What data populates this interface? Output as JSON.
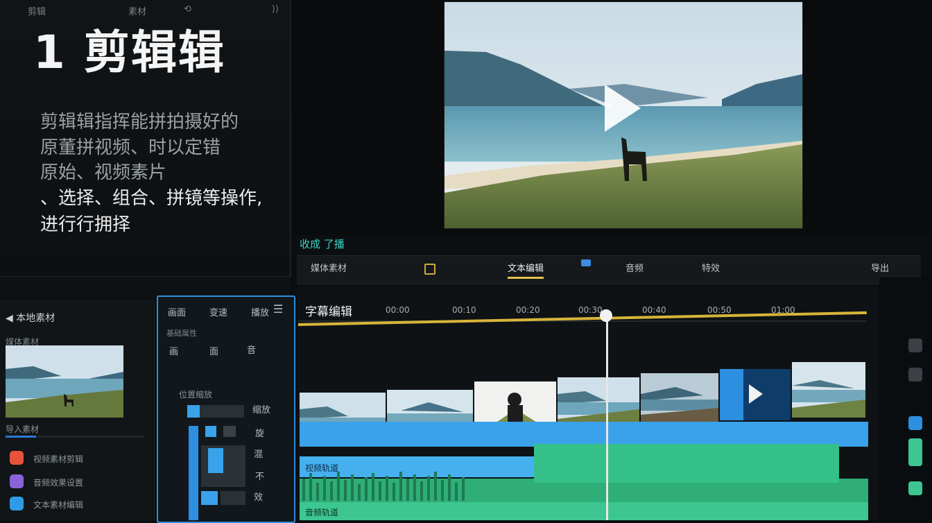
{
  "intro": {
    "title": "1 剪辑辑",
    "lines": [
      "剪辑辑指挥能拼拍摄好的",
      "原董拼视频、时以定错",
      "原始、视频素片",
      "、选择、组合、拼镜等操作,",
      "进行行拥择"
    ],
    "footer": [
      "剪辑",
      "素材",
      "⟲",
      "⟩⟩"
    ]
  },
  "preview": {
    "play_icon": "play-triangle"
  },
  "toolbar": {
    "status_label": "收成 了播"
  },
  "tabs": [
    "媒体素材",
    "",
    "文本编辑",
    "音频",
    "特效",
    "导出"
  ],
  "media": {
    "header": "◀ 本地素材",
    "sub": "媒体素材",
    "label": "导入素材",
    "progress": 0.22,
    "apps": [
      {
        "label": "视频素材剪辑",
        "color": "#e8543a"
      },
      {
        "label": "音频效果设置",
        "color": "#8a63d8"
      },
      {
        "label": "文本素材编辑",
        "color": "#2f9be8"
      }
    ]
  },
  "props": {
    "tabs": [
      "画面",
      "变速",
      "播放"
    ],
    "sub": "基础属性",
    "row": [
      "画",
      "面",
      "音"
    ],
    "section": "位置缩放",
    "items": [
      "缩放",
      "旋",
      "混",
      "不",
      "效"
    ]
  },
  "timeline": {
    "title": "字幕编辑",
    "ruler": [
      "00:00",
      "00:10",
      "00:20",
      "00:30",
      "00:40",
      "00:50",
      "01:00"
    ],
    "track_labels": {
      "blue": "视频轨道",
      "green": "音频轨道"
    }
  },
  "colors": {
    "accent_blue": "#2e8fe0",
    "accent_yellow": "#d8b43a",
    "audio_green": "#35c08a",
    "status_teal": "#36d3c7"
  }
}
